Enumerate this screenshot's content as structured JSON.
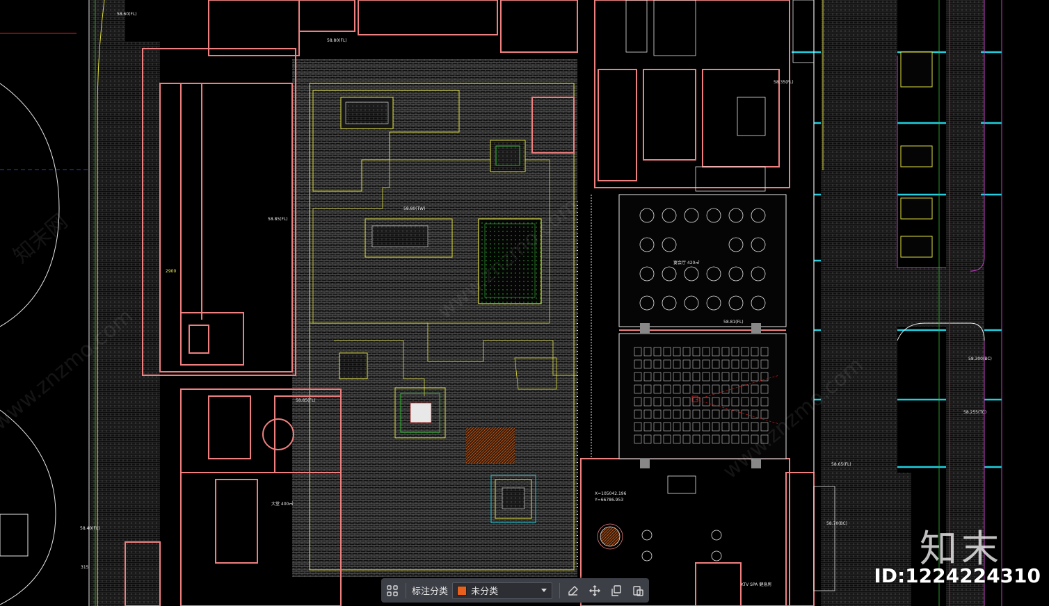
{
  "toolbar": {
    "category_label": "标注分类",
    "selected_category": "未分类",
    "category_swatch": "#e8601c",
    "icons": [
      "grid-icon",
      "edit-icon",
      "move-icon",
      "copy-icon",
      "paste-icon"
    ]
  },
  "watermark": {
    "brand": "知末",
    "id_text": "ID:1224224310",
    "site": "www.znzmo.com",
    "site_cn": "知末网"
  },
  "plan_labels": {
    "elev_1": "58.60(FL)",
    "elev_2": "58.80(FL)",
    "elev_3": "58.85(FL)",
    "elev_4": "58.80(TW)",
    "elev_5": "58.85(FL)",
    "elev_6": "58.81(FL)",
    "elev_7": "58.40(FL)",
    "elev_8": "58.35(FL)",
    "elev_9": "58.300(BC)",
    "elev_10": "58.255(TC)",
    "elev_11": "58.65(FL)",
    "elev_12": "58.70(BC)",
    "dim_1": "2900",
    "dim_2": "315",
    "coord_1": "X=105042.196",
    "coord_2": "Y=66786.953",
    "room_1": "宴会厅 420㎡",
    "room_2": "KTV SPA 健身房",
    "room_3": "大堂 400㎡"
  },
  "colors": {
    "wall": "#f08080",
    "paving": "#5a5a5a",
    "yellow": "#e0e040",
    "cyan": "#20d0e0",
    "green": "#30c030",
    "magenta": "#c040c0",
    "red": "#e02020",
    "white": "#e8e8e8",
    "orange": "#c06020"
  }
}
